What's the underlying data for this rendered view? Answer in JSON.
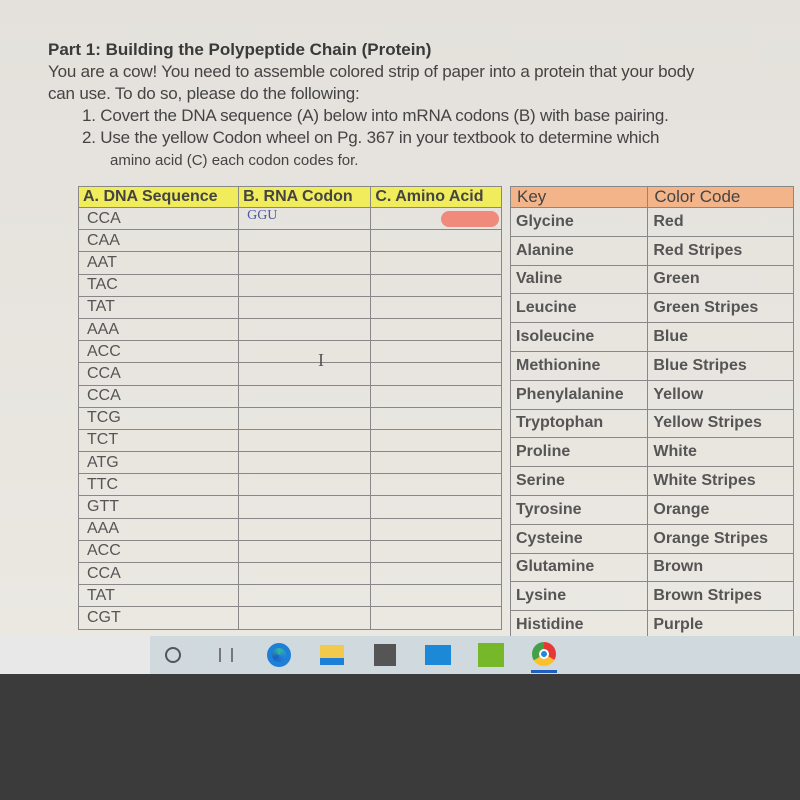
{
  "title": "Part 1: Building the Polypeptide Chain (Protein)",
  "intro_line1": "You are a cow!  You need to assemble colored strip of paper into a protein that your body",
  "intro_line2": "can use. To do so, please do the following:",
  "step1": "1.  Covert the DNA sequence (A) below into mRNA codons (B) with base pairing.",
  "step2_line1": "2.  Use the yellow Codon wheel on Pg. 367 in your textbook to determine which",
  "step2_line2": "amino acid (C) each codon codes for.",
  "dna_table": {
    "headers": [
      "A. DNA Sequence",
      "B. RNA Codon",
      "C. Amino Acid"
    ],
    "header_color": "#f0ec5c",
    "rows": [
      {
        "dna": "CCA",
        "rna": "GGU",
        "amino_marker_color": "#f08a7a"
      },
      {
        "dna": "CAA",
        "rna": ""
      },
      {
        "dna": "AAT",
        "rna": ""
      },
      {
        "dna": "TAC",
        "rna": ""
      },
      {
        "dna": "TAT",
        "rna": ""
      },
      {
        "dna": "AAA",
        "rna": ""
      },
      {
        "dna": "ACC",
        "rna": ""
      },
      {
        "dna": "CCA",
        "rna": ""
      },
      {
        "dna": "CCA",
        "rna": ""
      },
      {
        "dna": "TCG",
        "rna": ""
      },
      {
        "dna": "TCT",
        "rna": ""
      },
      {
        "dna": "ATG",
        "rna": ""
      },
      {
        "dna": "TTC",
        "rna": ""
      },
      {
        "dna": "GTT",
        "rna": ""
      },
      {
        "dna": "AAA",
        "rna": ""
      },
      {
        "dna": "ACC",
        "rna": ""
      },
      {
        "dna": "CCA",
        "rna": ""
      },
      {
        "dna": "TAT",
        "rna": ""
      },
      {
        "dna": "CGT",
        "rna": ""
      }
    ]
  },
  "key_table": {
    "headers": [
      "Key",
      "Color Code"
    ],
    "header_color": "#f4b48a",
    "rows": [
      [
        "Glycine",
        "Red"
      ],
      [
        "Alanine",
        "Red Stripes"
      ],
      [
        "Valine",
        "Green"
      ],
      [
        "Leucine",
        "Green Stripes"
      ],
      [
        "Isoleucine",
        "Blue"
      ],
      [
        "Methionine",
        "Blue Stripes"
      ],
      [
        "Phenylalanine",
        "Yellow"
      ],
      [
        "Tryptophan",
        "Yellow Stripes"
      ],
      [
        "Proline",
        "White"
      ],
      [
        "Serine",
        "White Stripes"
      ],
      [
        "Tyrosine",
        "Orange"
      ],
      [
        "Cysteine",
        "Orange Stripes"
      ],
      [
        "Glutamine",
        "Brown"
      ],
      [
        "Lysine",
        "Brown Stripes"
      ],
      [
        "Histidine",
        "Purple"
      ]
    ]
  },
  "taskbar": {
    "icons": [
      "search-circle-icon",
      "task-view-icon",
      "edge-icon",
      "file-explorer-icon",
      "store-icon",
      "mail-icon",
      "nvidia-icon",
      "chrome-icon"
    ]
  }
}
